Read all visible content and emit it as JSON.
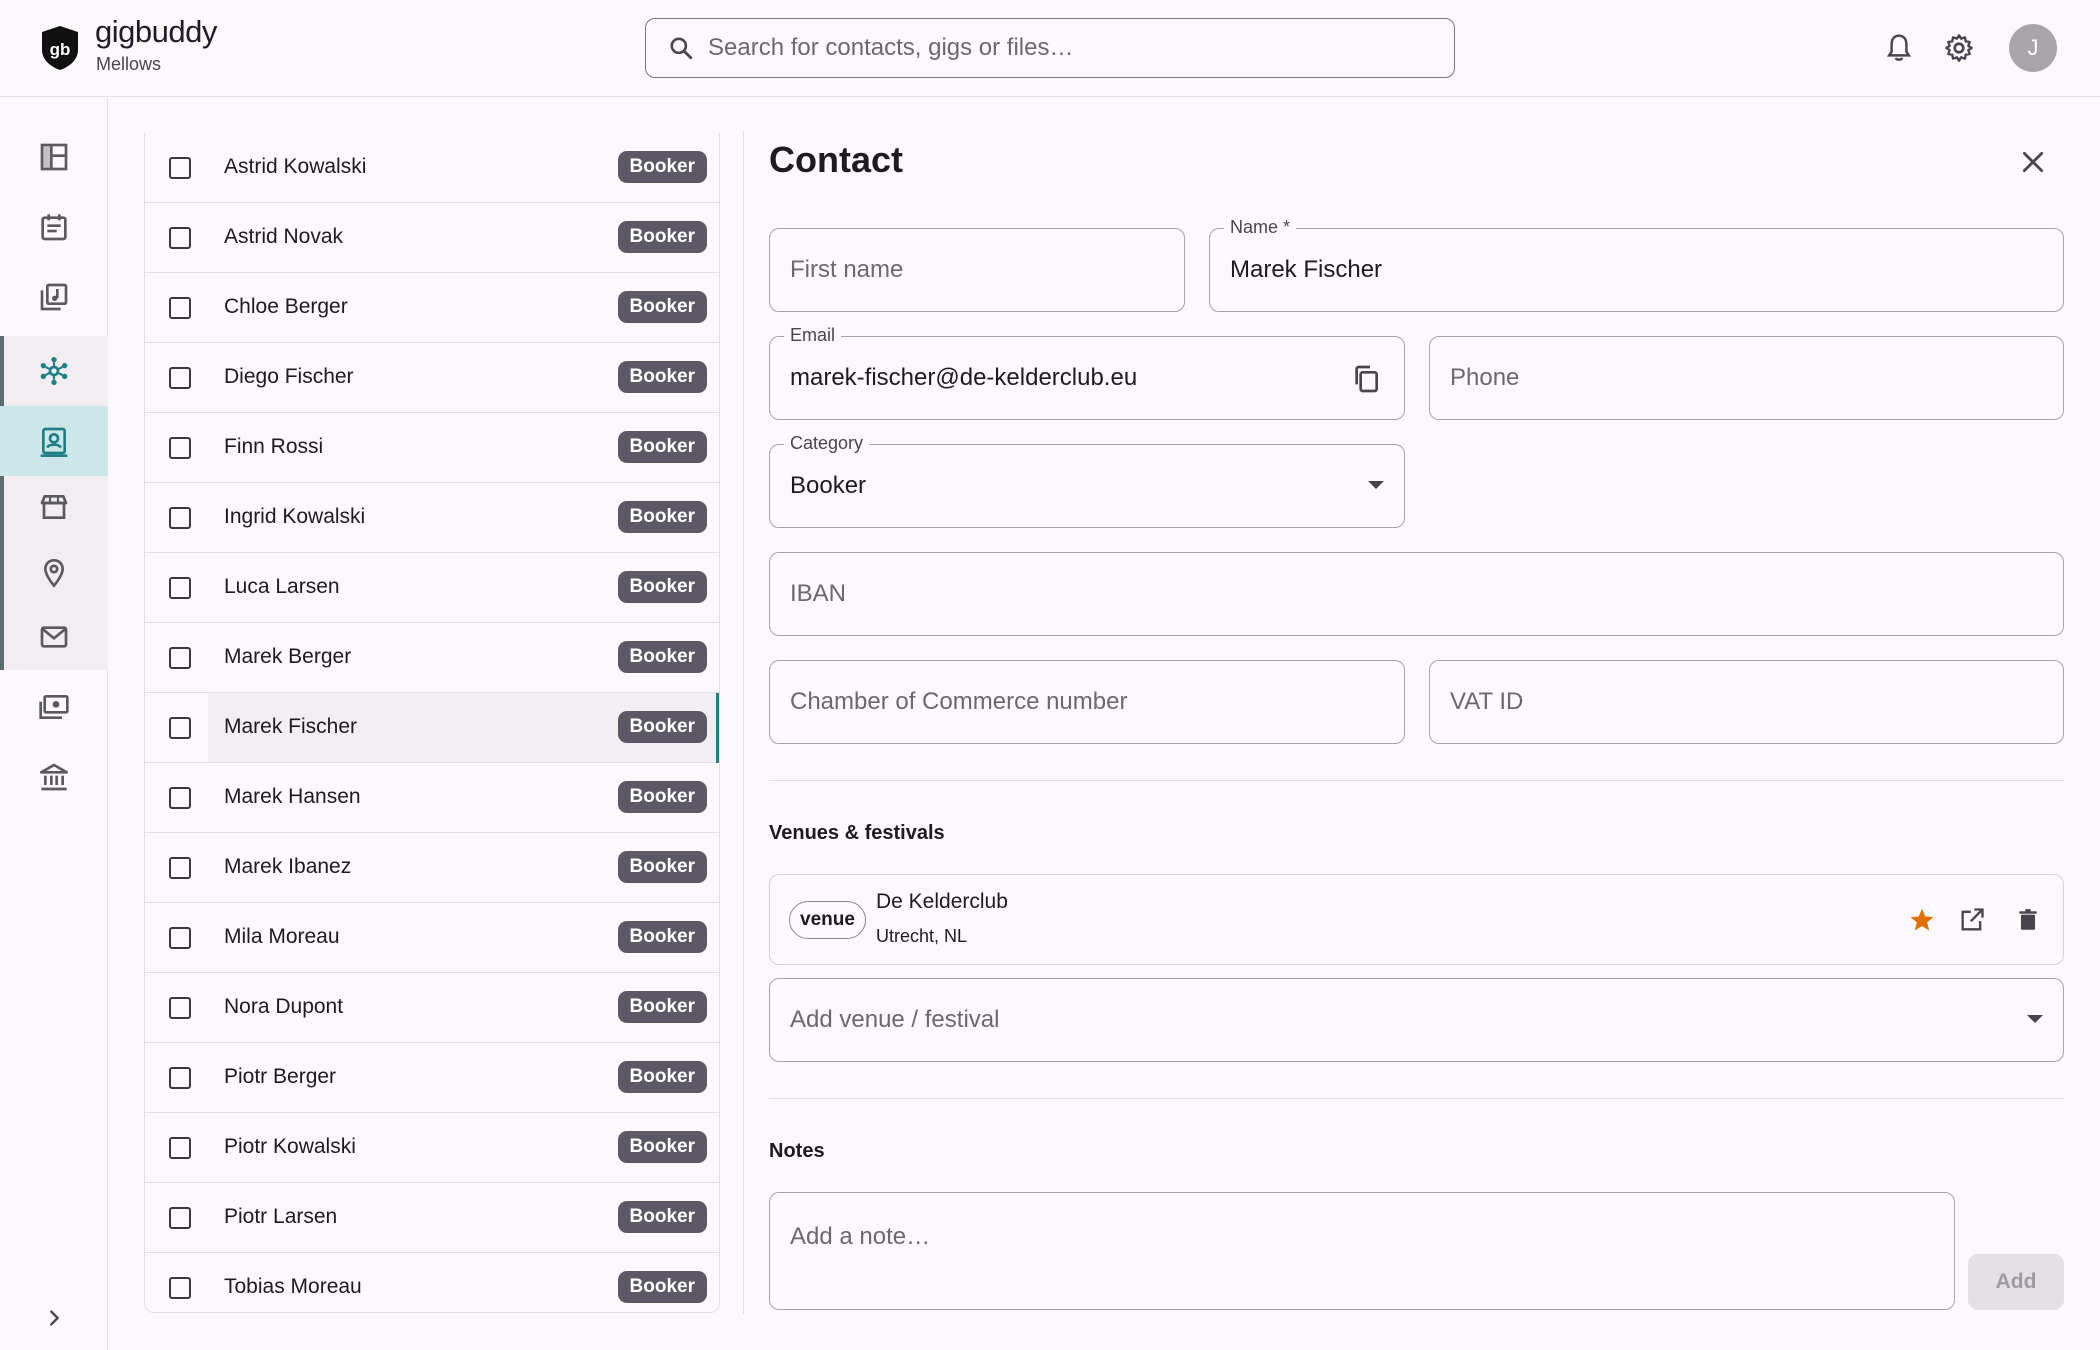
{
  "header": {
    "brand": "gigbuddy",
    "logo_monogram": "gb",
    "workspace": "Mellows",
    "search_placeholder": "Search for contacts, gigs or files…",
    "avatar_initial": "J",
    "icons": [
      "bell-icon",
      "gear-icon"
    ]
  },
  "rail": {
    "items": [
      "dashboard-icon",
      "calendar-icon",
      "music-library-icon",
      "network-icon",
      "contacts-icon",
      "store-icon",
      "location-pin-icon",
      "mail-icon",
      "cash-icon",
      "bank-icon"
    ],
    "active": "contacts-icon",
    "expand_icon": "chevron-right-icon"
  },
  "contacts": [
    {
      "name": "Astrid Kowalski",
      "category": "Booker"
    },
    {
      "name": "Astrid Novak",
      "category": "Booker"
    },
    {
      "name": "Chloe Berger",
      "category": "Booker"
    },
    {
      "name": "Diego Fischer",
      "category": "Booker"
    },
    {
      "name": "Finn Rossi",
      "category": "Booker"
    },
    {
      "name": "Ingrid Kowalski",
      "category": "Booker"
    },
    {
      "name": "Luca Larsen",
      "category": "Booker"
    },
    {
      "name": "Marek Berger",
      "category": "Booker"
    },
    {
      "name": "Marek Fischer",
      "category": "Booker",
      "selected": true
    },
    {
      "name": "Marek Hansen",
      "category": "Booker"
    },
    {
      "name": "Marek Ibanez",
      "category": "Booker"
    },
    {
      "name": "Mila Moreau",
      "category": "Booker"
    },
    {
      "name": "Nora Dupont",
      "category": "Booker"
    },
    {
      "name": "Piotr Berger",
      "category": "Booker"
    },
    {
      "name": "Piotr Kowalski",
      "category": "Booker"
    },
    {
      "name": "Piotr Larsen",
      "category": "Booker"
    },
    {
      "name": "Tobias Moreau",
      "category": "Booker"
    }
  ],
  "detail": {
    "title": "Contact",
    "first_name_placeholder": "First name",
    "name_label": "Name *",
    "name_value": "Marek Fischer",
    "email_label": "Email",
    "email_value": "marek-fischer@de-kelderclub.eu",
    "phone_placeholder": "Phone",
    "category_label": "Category",
    "category_value": "Booker",
    "iban_placeholder": "IBAN",
    "coc_placeholder": "Chamber of Commerce number",
    "vat_placeholder": "VAT ID",
    "venues_title": "Venues & festivals",
    "venue": {
      "type": "venue",
      "name": "De Kelderclub",
      "location": "Utrecht, NL",
      "starred": true
    },
    "add_venue_placeholder": "Add venue / festival",
    "notes_title": "Notes",
    "note_placeholder": "Add a note…",
    "add_label": "Add"
  },
  "colors": {
    "accent": "#1e7f86",
    "badge": "#5d5866",
    "star": "#e07000",
    "active_rail": "#cde6e7"
  }
}
